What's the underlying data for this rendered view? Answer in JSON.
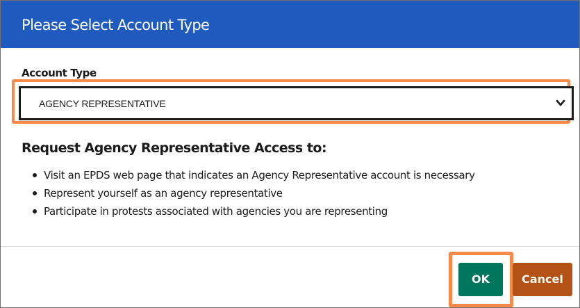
{
  "dialog": {
    "title": "Please Select Account Type"
  },
  "account_type": {
    "label": "Account Type",
    "selected": "AGENCY REPRESENTATIVE"
  },
  "access": {
    "heading": "Request Agency Representative Access to:",
    "items": [
      "Visit an EPDS web page that indicates an Agency Representative account is necessary",
      "Represent yourself as an agency representative",
      "Participate in protests associated with agencies you are representing"
    ]
  },
  "buttons": {
    "ok_label": "OK",
    "cancel_label": "Cancel"
  },
  "colors": {
    "header": "#1f5bbf",
    "highlight": "#f58a4b",
    "ok": "#00775c",
    "cancel": "#b35214"
  }
}
